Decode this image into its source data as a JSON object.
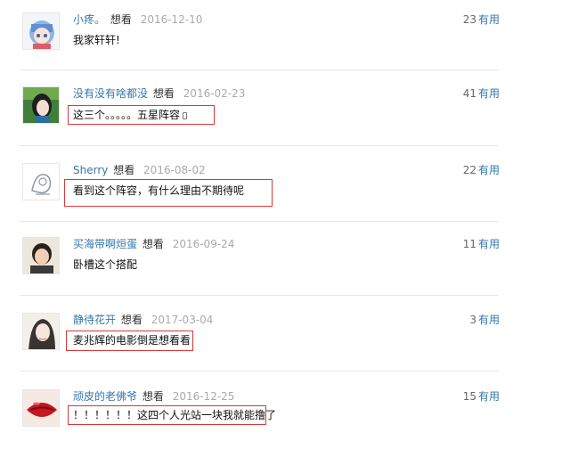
{
  "comments": [
    {
      "user": "小疼。",
      "status": "想看",
      "date": "2016-12-10",
      "votes": "23",
      "vote_unit": "有用",
      "text": "我家轩轩!"
    },
    {
      "user": "没有没有啥都没",
      "status": "想看",
      "date": "2016-02-23",
      "votes": "41",
      "vote_unit": "有用",
      "text": "这三个。。。。。五星阵容"
    },
    {
      "user": "Sherry",
      "status": "想看",
      "date": "2016-08-02",
      "votes": "22",
      "vote_unit": "有用",
      "text": "看到这个阵容，有什么理由不期待呢"
    },
    {
      "user": "买海带啊烜蛋",
      "status": "想看",
      "date": "2016-09-24",
      "votes": "11",
      "vote_unit": "有用",
      "text": "卧槽这个搭配"
    },
    {
      "user": "静待花开",
      "status": "想看",
      "date": "2017-03-04",
      "votes": "3",
      "vote_unit": "有用",
      "text": "麦兆辉的电影倒是想看看"
    },
    {
      "user": "顽皮的老佛爷",
      "status": "想看",
      "date": "2016-12-25",
      "votes": "15",
      "vote_unit": "有用",
      "text": "！！！！！！这四个人光站一块我就能撸了"
    }
  ],
  "icons": {
    "mobile": "mobile-phone-icon"
  },
  "colors": {
    "link": "#3377aa",
    "date": "#aaaaaa",
    "highlight": "#d9383a",
    "divider": "#e8e8e8"
  }
}
